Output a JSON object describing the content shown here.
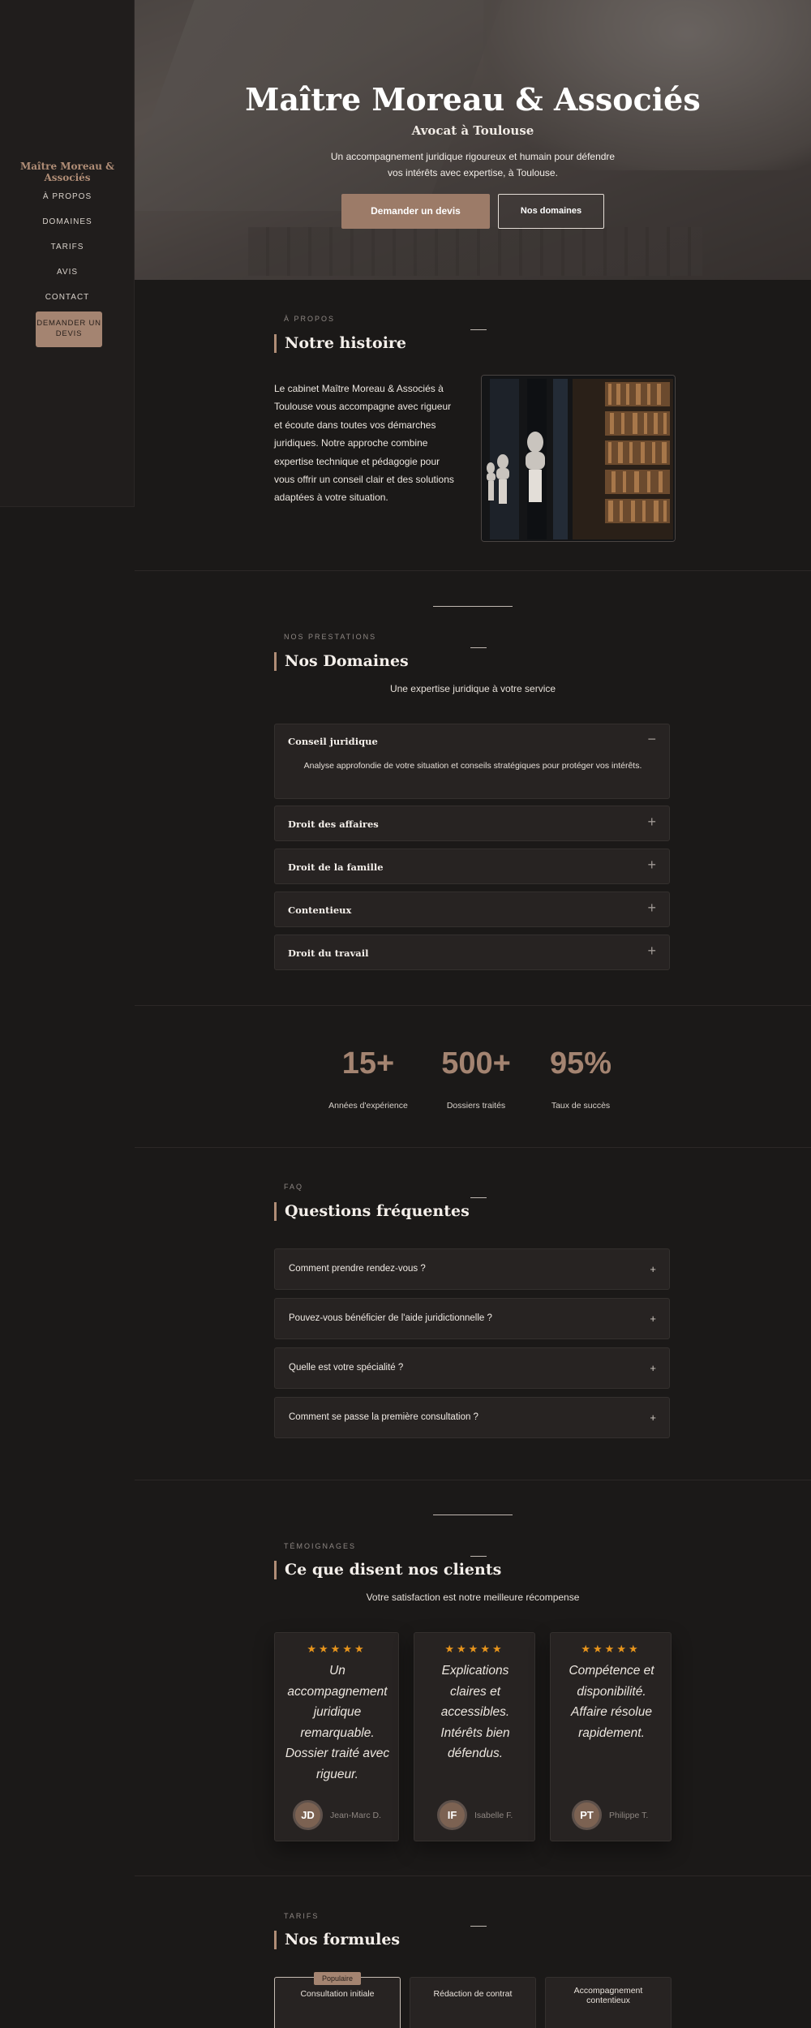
{
  "brand": "Maître Moreau & Associés",
  "nav": {
    "items": [
      "À PROPOS",
      "DOMAINES",
      "TARIFS",
      "AVIS",
      "CONTACT"
    ],
    "cta": "DEMANDER UN DEVIS"
  },
  "hero": {
    "title": "Maître Moreau & Associés",
    "subtitle": "Avocat à Toulouse",
    "description": "Un accompagnement juridique rigoureux et humain pour défendre vos intérêts avec expertise, à Toulouse.",
    "primary_button": "Demander un devis",
    "secondary_button": "Nos domaines"
  },
  "about": {
    "eyebrow": "À PROPOS",
    "heading": "Notre histoire",
    "text": "Le cabinet Maître Moreau & Associés à Toulouse vous accompagne avec rigueur et écoute dans toutes vos démarches juridiques. Notre approche combine expertise technique et pédagogie pour vous offrir un conseil clair et des solutions adaptées à votre situation."
  },
  "services": {
    "eyebrow": "NOS PRESTATIONS",
    "heading": "Nos Domaines",
    "subtitle": "Une expertise juridique à votre service",
    "items": [
      {
        "title": "Conseil juridique",
        "body": "Analyse approfondie de votre situation et conseils stratégiques pour protéger vos intérêts.",
        "sign": "−"
      },
      {
        "title": "Droit des affaires",
        "sign": "+"
      },
      {
        "title": "Droit de la famille",
        "sign": "+"
      },
      {
        "title": "Contentieux",
        "sign": "+"
      },
      {
        "title": "Droit du travail",
        "sign": "+"
      }
    ]
  },
  "stats": [
    {
      "value": "15+",
      "label": "Années d'expérience"
    },
    {
      "value": "500+",
      "label": "Dossiers traités"
    },
    {
      "value": "95%",
      "label": "Taux de succès"
    }
  ],
  "faq": {
    "eyebrow": "FAQ",
    "heading": "Questions fréquentes",
    "items": [
      "Comment prendre rendez-vous ?",
      "Pouvez-vous bénéficier de l'aide juridictionnelle ?",
      "Quelle est votre spécialité ?",
      "Comment se passe la première consultation ?"
    ],
    "toggle": "+"
  },
  "testimonials": {
    "eyebrow": "TÉMOIGNAGES",
    "heading": "Ce que disent nos clients",
    "subtitle": "Votre satisfaction est notre meilleure récompense",
    "stars": "★★★★★",
    "rating": 5,
    "items": [
      {
        "quote": "Un accompagnement juridique remarquable. Dossier traité avec rigueur.",
        "initials": "JD",
        "name": "Jean-Marc D."
      },
      {
        "quote": "Explications claires et accessibles. Intérêts bien défendus.",
        "initials": "IF",
        "name": "Isabelle F."
      },
      {
        "quote": "Compétence et disponibilité. Affaire résolue rapidement.",
        "initials": "PT",
        "name": "Philippe T."
      }
    ]
  },
  "pricing": {
    "eyebrow": "TARIFS",
    "heading": "Nos formules",
    "badge": "Populaire",
    "plans": [
      "Consultation initiale",
      "Rédaction de contrat",
      "Accompagnement contentieux"
    ]
  },
  "colors": {
    "background": "#1b1918",
    "accent": "#a48471",
    "star": "#e8951c"
  }
}
